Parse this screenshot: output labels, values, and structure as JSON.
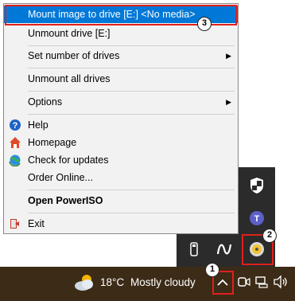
{
  "menu": {
    "items": [
      {
        "label": "Mount image to drive [E:] <No media>",
        "highlighted": true
      },
      {
        "label": "Unmount drive [E:]"
      },
      {
        "label": "Set number of drives",
        "submenu": true
      },
      {
        "label": "Unmount all drives"
      },
      {
        "label": "Options",
        "submenu": true
      },
      {
        "label": "Help",
        "icon": "help-icon"
      },
      {
        "label": "Homepage",
        "icon": "home-icon"
      },
      {
        "label": "Check for updates",
        "icon": "update-globe-icon"
      },
      {
        "label": "Order Online..."
      },
      {
        "label": "Open PowerISO",
        "bold": true
      },
      {
        "label": "Exit",
        "icon": "exit-icon"
      }
    ],
    "submenu_arrow": "▶"
  },
  "callouts": {
    "one": "1",
    "two": "2",
    "three": "3"
  },
  "taskbar": {
    "temperature": "18°C",
    "weather": "Mostly cloudy",
    "chevron": "^"
  },
  "colors": {
    "menu_highlight": "#0078d7",
    "callout_red": "#e0201b",
    "taskbar_bg": "#3c2b17"
  }
}
